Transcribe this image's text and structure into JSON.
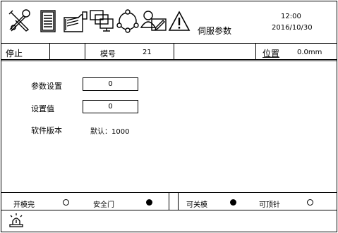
{
  "toolbar": {
    "icons": [
      "tools-icon",
      "document-icon",
      "folder-icon",
      "monitors-icon",
      "network-icon",
      "user-edit-icon",
      "warning-icon"
    ],
    "page_title": "伺服参数",
    "time": "12:00",
    "date": "2016/10/30"
  },
  "status": {
    "state": "停止",
    "mold_label": "模号",
    "mold_value": "21",
    "position_label": "位置",
    "position_value": "0.0mm"
  },
  "params": {
    "param_setting_label": "参数设置",
    "param_setting_value": "0",
    "set_value_label": "设置值",
    "set_value_value": "0",
    "software_version_label": "软件版本",
    "software_version_value": "默认：1000"
  },
  "signals": {
    "mold_open_done_label": "开模完",
    "mold_open_done_on": false,
    "safety_door_label": "安全门",
    "safety_door_on": true,
    "can_close_mold_label": "可关模",
    "can_close_mold_on": true,
    "can_eject_label": "可顶针",
    "can_eject_on": false
  },
  "footer": {
    "icon": "alarm-lamp-icon"
  }
}
